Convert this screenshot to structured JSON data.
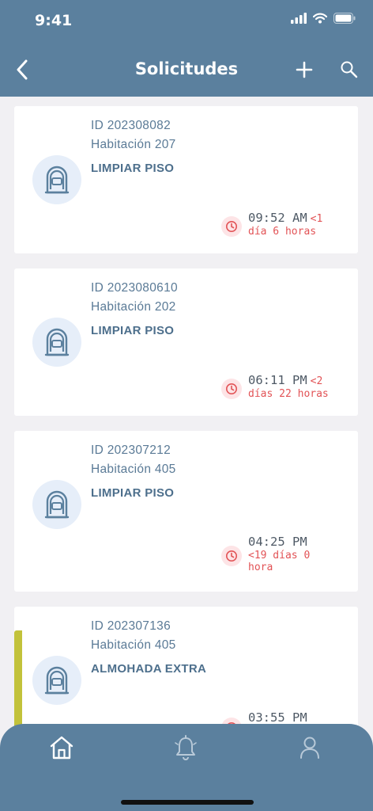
{
  "status_bar": {
    "time": "9:41"
  },
  "nav": {
    "title": "Solicitudes"
  },
  "requests": [
    {
      "id": "ID 202308082",
      "room": "Habitación 207",
      "task": "LIMPIAR PISO",
      "time": "09:52 AM",
      "elapsed_a": "<1",
      "elapsed_b": "día 6 horas"
    },
    {
      "id": "ID 2023080610",
      "room": "Habitación 202",
      "task": "LIMPIAR PISO",
      "time": "06:11 PM",
      "elapsed_a": "<2",
      "elapsed_b": "días 22 horas"
    },
    {
      "id": "ID 202307212",
      "room": "Habitación 405",
      "task": "LIMPIAR PISO",
      "time": "04:25 PM",
      "elapsed_a": "<19 días 0",
      "elapsed_b": "hora"
    },
    {
      "id": "ID 202307136",
      "room": "Habitación 405",
      "task": "ALMOHADA EXTRA",
      "time": "03:55 PM"
    }
  ],
  "colors": {
    "header": "#5b809e",
    "accent_flag": "#c2c23a",
    "overdue": "#e25356"
  },
  "tabbar": {
    "items": [
      "home-icon",
      "bell-icon",
      "user-icon"
    ]
  }
}
